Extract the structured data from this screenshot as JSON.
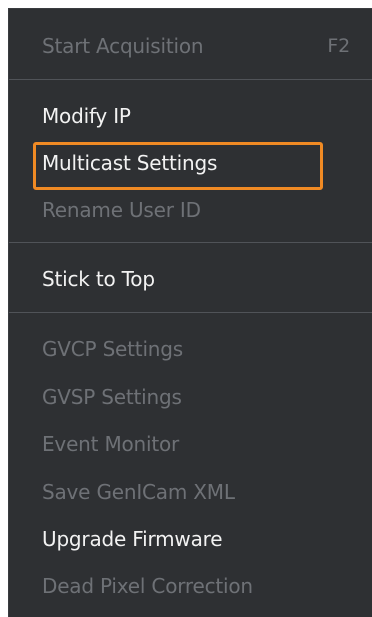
{
  "menu": {
    "items": [
      {
        "label": "Start Acquisition",
        "shortcut": "F2",
        "enabled": false
      },
      {
        "label": "Modify IP",
        "enabled": true
      },
      {
        "label": "Multicast Settings",
        "enabled": true,
        "highlighted": true
      },
      {
        "label": "Rename User ID",
        "enabled": false
      },
      {
        "label": "Stick to Top",
        "enabled": true
      },
      {
        "label": "GVCP Settings",
        "enabled": false
      },
      {
        "label": "GVSP Settings",
        "enabled": false
      },
      {
        "label": "Event Monitor",
        "enabled": false
      },
      {
        "label": "Save GenICam XML",
        "enabled": false
      },
      {
        "label": "Upgrade Firmware",
        "enabled": true
      },
      {
        "label": "Dead Pixel Correction",
        "enabled": false
      }
    ]
  },
  "colors": {
    "menu_background": "#2e3033",
    "enabled_text": "#f2f2f2",
    "disabled_text": "#6e7176",
    "separator": "#505358",
    "highlight_border": "#f08a24"
  }
}
